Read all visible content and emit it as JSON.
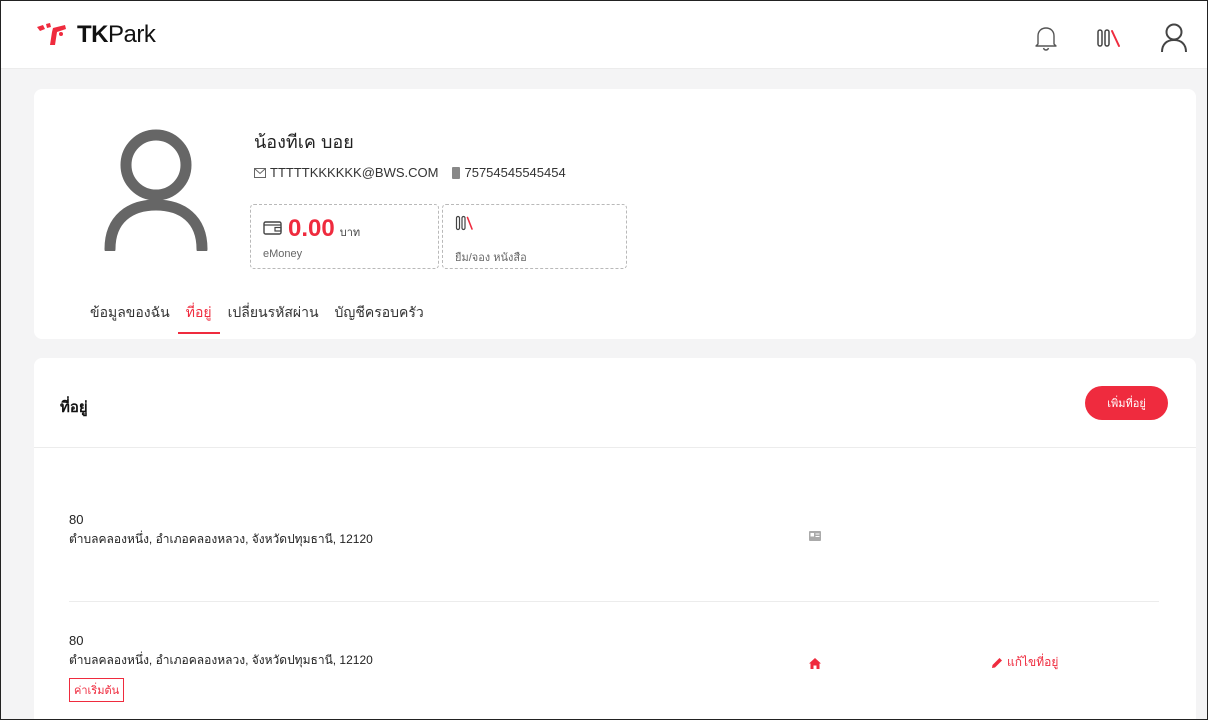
{
  "brand": {
    "name_bold": "TK",
    "name_rest": "Park",
    "accent": "#ef2b3e"
  },
  "header": {
    "icons": [
      "bell-icon",
      "books-icon",
      "user-icon"
    ]
  },
  "profile": {
    "name": "น้องทีเค บอย",
    "email": "TTTTTKKKKKK@BWS.COM",
    "phone": "75754545545454",
    "emoney": {
      "amount": "0.00",
      "unit": "บาท",
      "label": "eMoney"
    },
    "borrow": {
      "label": "ยืม/จอง หนังสือ"
    }
  },
  "tabs": [
    {
      "label": "ข้อมูลของฉัน",
      "active": false
    },
    {
      "label": "ที่อยู่",
      "active": true
    },
    {
      "label": "เปลี่ยนรหัสผ่าน",
      "active": false
    },
    {
      "label": "บัญชีครอบครัว",
      "active": false
    }
  ],
  "address_section": {
    "title": "ที่อยู่",
    "add_button": "เพิ่มที่อยู่",
    "rows": [
      {
        "line1": "80",
        "line2": "ตำบลคลองหนึ่ง, อำเภอคลองหลวง, จังหวัดปทุมธานี, 12120",
        "icon": "id-card-icon"
      },
      {
        "line1": "80",
        "line2": "ตำบลคลองหนึ่ง, อำเภอคลองหลวง, จังหวัดปทุมธานี, 12120",
        "badge": "ค่าเริ่มต้น",
        "icon": "home-icon",
        "edit_label": "แก้ไขที่อยู่"
      }
    ]
  }
}
